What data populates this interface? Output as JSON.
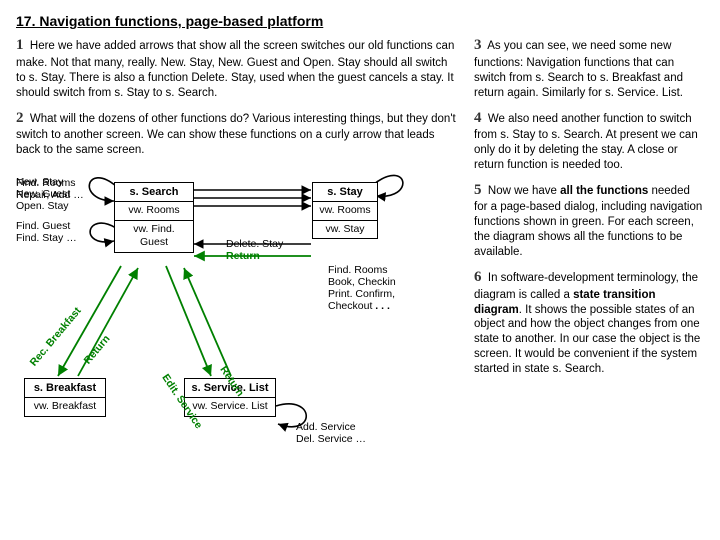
{
  "title": "17. Navigation functions, page-based platform",
  "left": {
    "p1_num": "1",
    "p1": "Here we have added arrows that show all the screen switches our old functions can make. Not that many, really. New. Stay, New. Guest and Open. Stay should all switch to s. Stay. There is also a function Delete. Stay, used when the guest cancels a stay. It should switch from s. Stay to s. Search.",
    "p2_num": "2",
    "p2": "What will the dozens of other functions do? Various interesting things, but they don't switch to another screen. We can show these functions on a curly arrow that leads back to the same screen."
  },
  "right": {
    "p3_num": "3",
    "p3": "As you can see, we need some new functions: Navigation functions that can switch from s. Search to s. Breakfast and return again. Similarly for s. Service. List.",
    "p4_num": "4",
    "p4": "We also need another function to switch from s. Stay to s. Search. At present we can only do it by deleting the stay. A close or return function is needed too.",
    "p5_num": "5",
    "p5a": "Now we have ",
    "p5b": "all the functions",
    "p5c": " needed for a page-based dialog, including navigation functions shown in green. For each screen, the diagram shows all the functions to be available.",
    "p6_num": "6",
    "p6a": "In software-development terminology, the diagram is called a ",
    "p6b": "state transition diagram",
    "p6c": ". It shows the possible states of an object and how the object changes from one state to another. In our case the object is the screen. It would be convenient if the system started in state s. Search."
  },
  "diagram": {
    "search": {
      "title": "s. Search",
      "b1": "vw. Rooms",
      "b2": "vw. Find. Guest"
    },
    "stay": {
      "title": "s. Stay",
      "b1": "vw. Rooms",
      "b2": "vw. Stay"
    },
    "breakfast": {
      "title": "s. Breakfast",
      "b1": "vw. Breakfast"
    },
    "service": {
      "title": "s. Service. List",
      "b1": "vw. Service. List"
    },
    "lbl_search_left_1": "Find. Rooms",
    "lbl_search_left_2": "Repair, Add …",
    "lbl_search_left_3": "Find. Guest",
    "lbl_search_left_4": "Find. Stay …",
    "lbl_mid_1": "New. Stay",
    "lbl_mid_2": "New. Guest",
    "lbl_mid_3": "Open. Stay",
    "lbl_mid_4": "Delete. Stay",
    "lbl_mid_return": "Return",
    "lbl_stay_right_1": "Find. Rooms",
    "lbl_stay_right_2": "Book, Checkin",
    "lbl_stay_right_3": "Print. Confirm,",
    "lbl_stay_right_4": "Checkout",
    "lbl_stay_right_5": ". . .",
    "lbl_svc_below_1": "Add. Service",
    "lbl_svc_below_2": "Del. Service …",
    "rot_recbreakfast": "Rec. Breakfast",
    "rot_return1": "Return",
    "rot_editservice": "Edit. Service",
    "rot_return2": "Return"
  }
}
